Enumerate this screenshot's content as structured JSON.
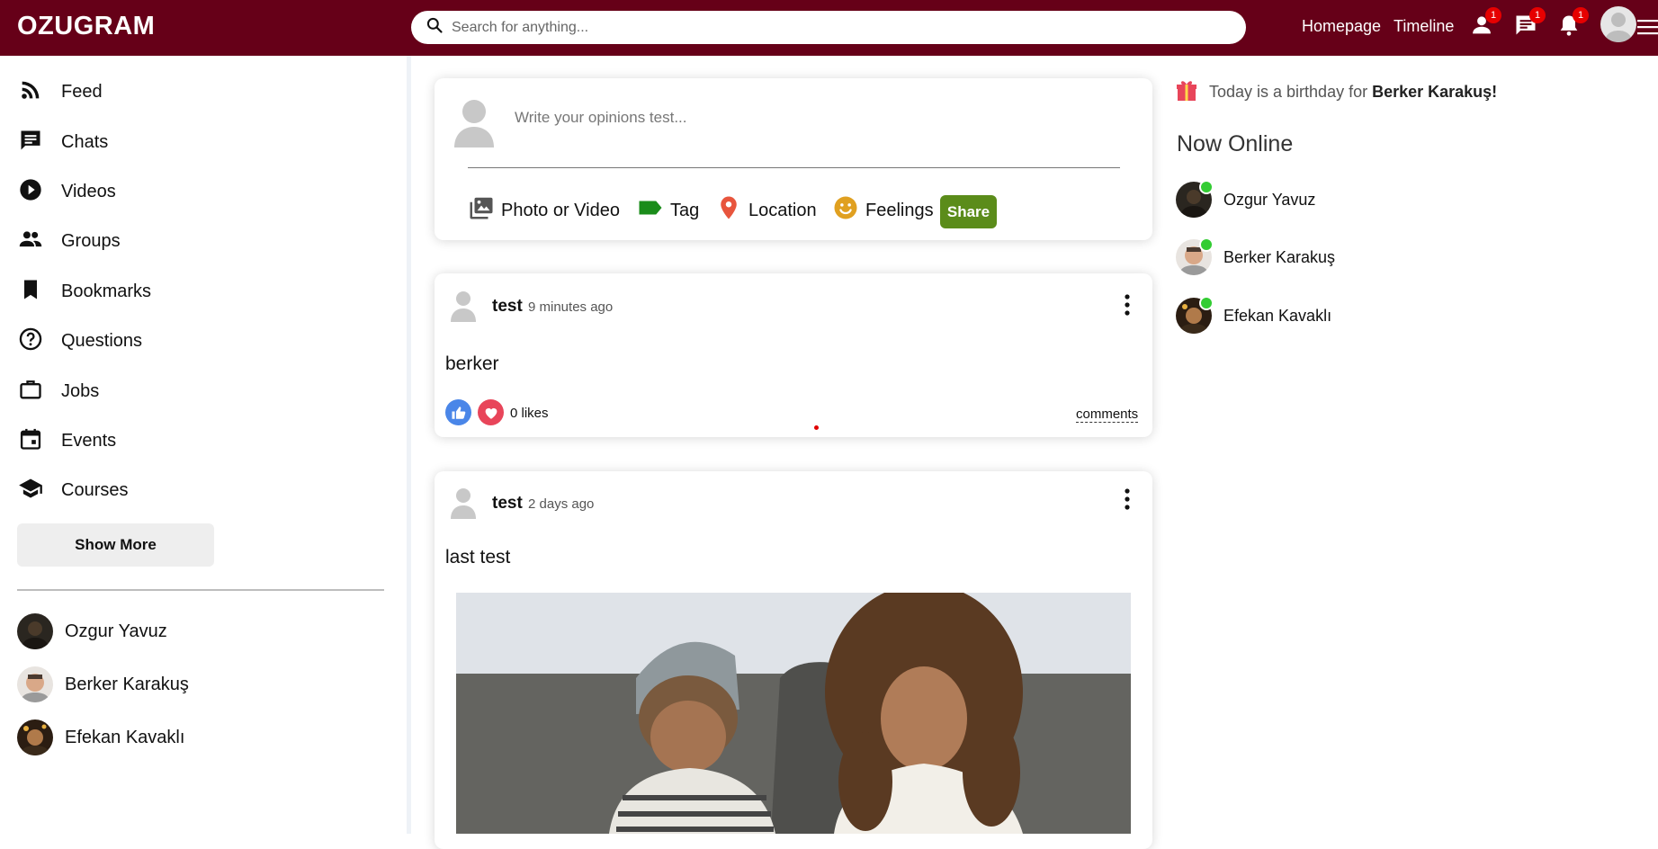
{
  "header": {
    "logo": "OZUGRAM",
    "search_placeholder": "Search for anything...",
    "links": [
      "Homepage",
      "Timeline"
    ],
    "badges": {
      "friends": "1",
      "messages": "1",
      "notifications": "1"
    }
  },
  "sidebar": {
    "items": [
      {
        "label": "Feed",
        "icon": "rss-feed-icon"
      },
      {
        "label": "Chats",
        "icon": "chat-icon"
      },
      {
        "label": "Videos",
        "icon": "play-circle-icon"
      },
      {
        "label": "Groups",
        "icon": "group-icon"
      },
      {
        "label": "Bookmarks",
        "icon": "bookmark-icon"
      },
      {
        "label": "Questions",
        "icon": "help-circle-icon"
      },
      {
        "label": "Jobs",
        "icon": "briefcase-icon"
      },
      {
        "label": "Events",
        "icon": "calendar-icon"
      },
      {
        "label": "Courses",
        "icon": "school-icon"
      }
    ],
    "show_more": "Show More",
    "friends": [
      "Ozgur Yavuz",
      "Berker Karakuş",
      "Efekan Kavaklı"
    ]
  },
  "share": {
    "placeholder": "Write your opinions test...",
    "options": [
      {
        "label": "Photo or Video",
        "icon": "photo-library-icon",
        "color": "#555555"
      },
      {
        "label": "Tag",
        "icon": "label-icon",
        "color": "#1a8c1a"
      },
      {
        "label": "Location",
        "icon": "location-pin-icon",
        "color": "#e8553d"
      },
      {
        "label": "Feelings",
        "icon": "emoji-icon",
        "color": "#e0a020"
      }
    ],
    "button": "Share",
    "button_color": "#5b8c1a"
  },
  "posts": [
    {
      "user": "test",
      "time": "9 minutes ago",
      "text": "berker",
      "likes": "0 likes",
      "comments": "comments"
    },
    {
      "user": "test",
      "time": "2 days ago",
      "text": "last test"
    }
  ],
  "right": {
    "birthday_prefix": "Today is a birthday for ",
    "birthday_name": "Berker Karakuş!",
    "online_title": "Now Online",
    "online": [
      "Ozgur Yavuz",
      "Berker Karakuş",
      "Efekan Kavaklı"
    ]
  },
  "colors": {
    "topbar": "#660018",
    "like": "#4a86e8",
    "love": "#e8455a",
    "online": "#33cc33"
  }
}
